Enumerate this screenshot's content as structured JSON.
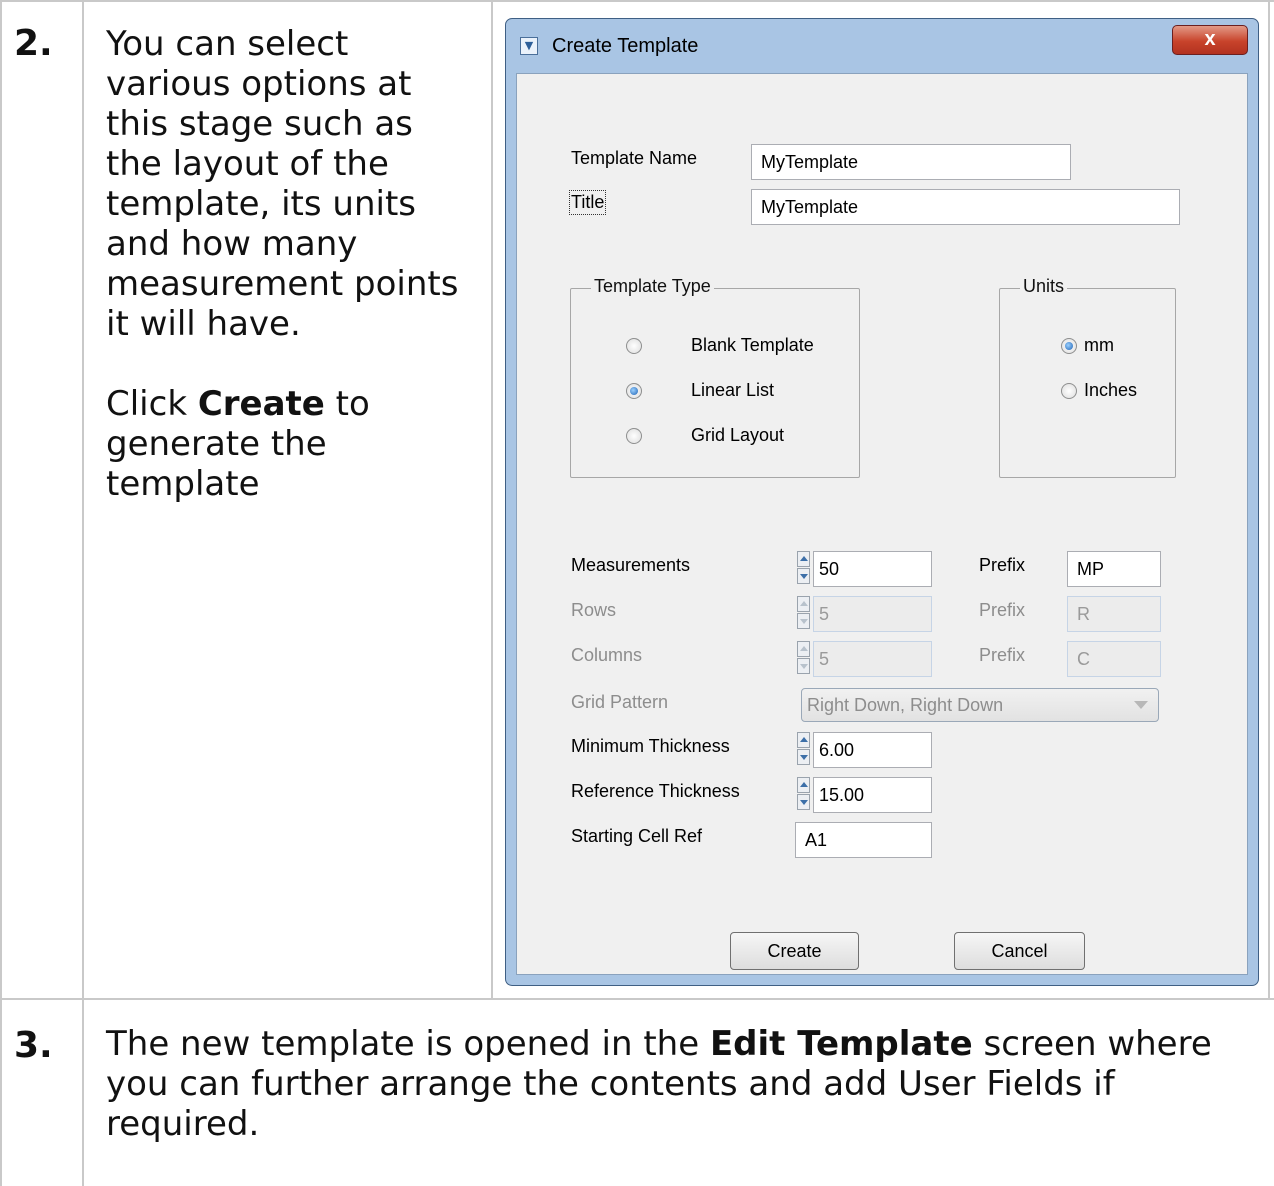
{
  "step2": {
    "number": "2.",
    "text": "You can select various options at this stage such as the layout of the template, its units and how many measurement points it will have.",
    "click_pre": "Click ",
    "click_bold": "Create",
    "click_post": " to generate the template"
  },
  "step3": {
    "number": "3.",
    "text_pre": "The new template is opened in the ",
    "text_bold": "Edit Template",
    "text_post": " screen where you can further arrange the contents and add User Fields if required."
  },
  "dialog": {
    "title": "Create Template",
    "close_glyph": "x",
    "template_name_label": "Template Name",
    "template_name_value": "MyTemplate",
    "title_label": "Title",
    "title_value": "MyTemplate",
    "template_type": {
      "group_label": "Template Type",
      "options": [
        "Blank Template",
        "Linear List",
        "Grid Layout"
      ],
      "selected": "Linear List"
    },
    "units": {
      "group_label": "Units",
      "options": [
        "mm",
        "Inches"
      ],
      "selected": "mm"
    },
    "measurements_label": "Measurements",
    "measurements_value": "50",
    "rows_label": "Rows",
    "rows_value": "5",
    "columns_label": "Columns",
    "columns_value": "5",
    "prefix_label": "Prefix",
    "measurements_prefix": "MP",
    "rows_prefix": "R",
    "columns_prefix": "C",
    "grid_pattern_label": "Grid Pattern",
    "grid_pattern_value": "Right Down, Right Down",
    "min_thickness_label": "Minimum Thickness",
    "min_thickness_value": "6.00",
    "ref_thickness_label": "Reference Thickness",
    "ref_thickness_value": "15.00",
    "start_cell_label": "Starting Cell Ref",
    "start_cell_value": "A1",
    "create_button": "Create",
    "cancel_button": "Cancel"
  }
}
